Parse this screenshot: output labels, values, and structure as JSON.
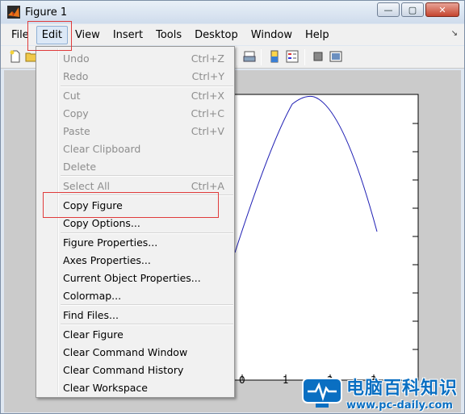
{
  "window": {
    "title": "Figure 1",
    "controls": {
      "minimize": "—",
      "maximize": "▢",
      "close": "✕"
    }
  },
  "menubar": {
    "items": [
      "File",
      "Edit",
      "View",
      "Insert",
      "Tools",
      "Desktop",
      "Window",
      "Help"
    ],
    "active": "Edit",
    "pin_icon": "↘"
  },
  "edit_menu": {
    "items": [
      {
        "label": "Undo",
        "shortcut": "Ctrl+Z",
        "enabled": false
      },
      {
        "label": "Redo",
        "shortcut": "Ctrl+Y",
        "enabled": false
      },
      {
        "label": "Cut",
        "shortcut": "Ctrl+X",
        "enabled": false
      },
      {
        "label": "Copy",
        "shortcut": "Ctrl+C",
        "enabled": false
      },
      {
        "label": "Paste",
        "shortcut": "Ctrl+V",
        "enabled": false
      },
      {
        "label": "Clear Clipboard",
        "shortcut": "",
        "enabled": false
      },
      {
        "label": "Delete",
        "shortcut": "",
        "enabled": false
      },
      {
        "label": "Select All",
        "shortcut": "Ctrl+A",
        "enabled": false
      },
      {
        "label": "Copy Figure",
        "shortcut": "",
        "enabled": true
      },
      {
        "label": "Copy Options...",
        "shortcut": "",
        "enabled": true
      },
      {
        "label": "Figure Properties...",
        "shortcut": "",
        "enabled": true
      },
      {
        "label": "Axes Properties...",
        "shortcut": "",
        "enabled": true
      },
      {
        "label": "Current Object Properties...",
        "shortcut": "",
        "enabled": true
      },
      {
        "label": "Colormap...",
        "shortcut": "",
        "enabled": true
      },
      {
        "label": "Find Files...",
        "shortcut": "",
        "enabled": true
      },
      {
        "label": "Clear Figure",
        "shortcut": "",
        "enabled": true
      },
      {
        "label": "Clear Command Window",
        "shortcut": "",
        "enabled": true
      },
      {
        "label": "Clear Command History",
        "shortcut": "",
        "enabled": true
      },
      {
        "label": "Clear Workspace",
        "shortcut": "",
        "enabled": true
      }
    ]
  },
  "axes": {
    "xtick_labels": [
      "0",
      "1",
      "2",
      "3"
    ],
    "line_color": "#1f1fb4"
  },
  "watermark": {
    "text": "电脑百科知识",
    "url": "www.pc-daily.com"
  }
}
